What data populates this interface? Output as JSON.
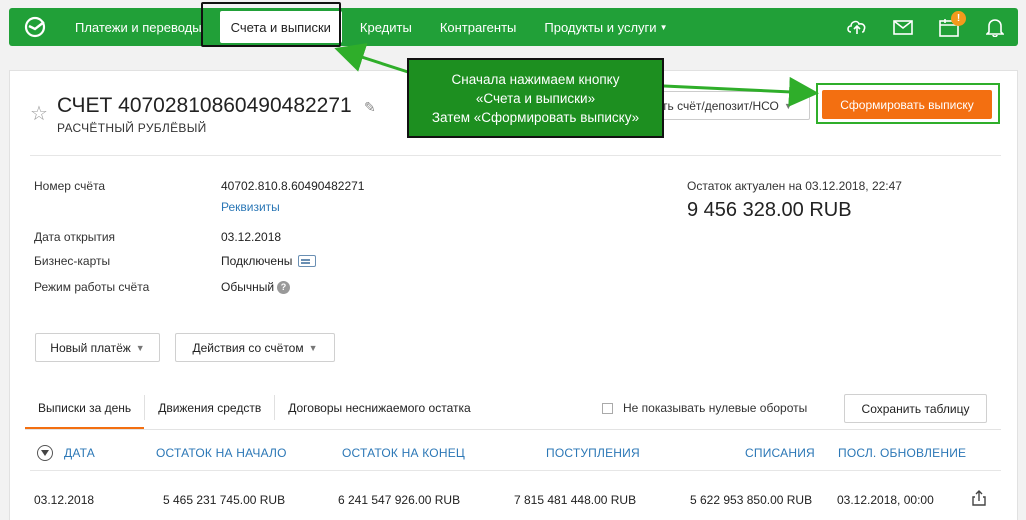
{
  "nav": {
    "items": [
      {
        "label": "Платежи и переводы"
      },
      {
        "label": "Счета и выписки"
      },
      {
        "label": "Кредиты"
      },
      {
        "label": "Контрагенты"
      },
      {
        "label": "Продукты и услуги"
      }
    ],
    "active_index": 1,
    "notification_badge": "!",
    "icons": [
      "cloud-upload-icon",
      "mail-icon",
      "calendar-icon",
      "bell-icon"
    ],
    "brand_color": "#21a038"
  },
  "account": {
    "title": "СЧЕТ 40702810860490482271",
    "subtitle": "РАСЧЁТНЫЙ РУБЛЁВЫЙ",
    "select_label": "ть счёт/депозит/НСО",
    "statement_button": "Сформировать выписку",
    "statement_button_color": "#f36f11"
  },
  "details": {
    "account_number_label": "Номер счёта",
    "account_number_value": "40702.810.8.60490482271",
    "requisites_link": "Реквизиты",
    "open_date_label": "Дата открытия",
    "open_date_value": "03.12.2018",
    "business_cards_label": "Бизнес-карты",
    "business_cards_value": "Подключены",
    "mode_label": "Режим работы счёта",
    "mode_value": "Обычный",
    "balance_label": "Остаток актуален на 03.12.2018, 22:47",
    "balance_value": "9 456 328.00 RUB"
  },
  "actions": {
    "new_payment": "Новый платёж",
    "account_actions": "Действия со счётом"
  },
  "tabs": [
    {
      "label": "Выписки за день",
      "active": true
    },
    {
      "label": "Движения средств",
      "active": false
    },
    {
      "label": "Договоры неснижаемого остатка",
      "active": false
    }
  ],
  "filter": {
    "hide_zero_label": "Не показывать нулевые обороты",
    "hide_zero_checked": false,
    "save_table_button": "Сохранить таблицу"
  },
  "table": {
    "headers": [
      "ДАТА",
      "ОСТАТОК НА НАЧАЛО",
      "ОСТАТОК НА КОНЕЦ",
      "ПОСТУПЛЕНИЯ",
      "СПИСАНИЯ",
      "ПОСЛ. ОБНОВЛЕНИЕ"
    ],
    "rows": [
      [
        "03.12.2018",
        "5 465 231 745.00 RUB",
        "6 241 547 926.00 RUB",
        "7 815 481 448.00 RUB",
        "5 622 953 850.00 RUB",
        "03.12.2018, 00:00"
      ]
    ],
    "header_color": "#2b77b6"
  },
  "callout": {
    "line1": "Сначала нажимаем кнопку",
    "line2": "«Счета и выписки»",
    "line3": "Затем «Сформировать выписку»",
    "color": "#1d8f20"
  }
}
